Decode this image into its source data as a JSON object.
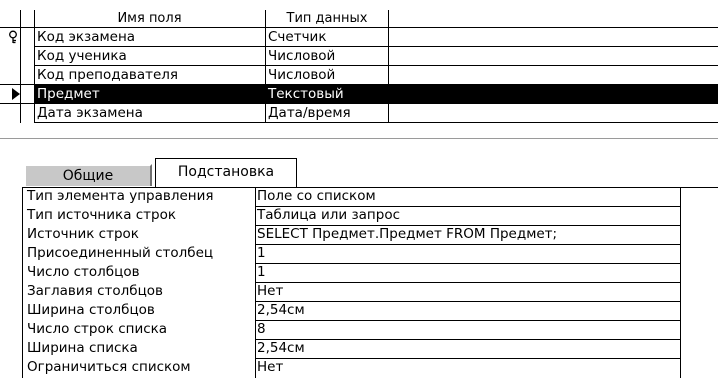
{
  "field_grid": {
    "columns": {
      "name": "Имя поля",
      "type": "Тип данных"
    },
    "rows": [
      {
        "name": "Код экзамена",
        "type": "Счетчик",
        "indicator": "key-icon"
      },
      {
        "name": "Код ученика",
        "type": "Числовой",
        "indicator": ""
      },
      {
        "name": "Код преподавателя",
        "type": "Числовой",
        "indicator": ""
      },
      {
        "name": "Предмет",
        "type": "Текстовый",
        "indicator": "current-row-arrow-icon",
        "selected": true
      },
      {
        "name": "Дата экзамена",
        "type": "Дата/время",
        "indicator": ""
      }
    ]
  },
  "tabs": {
    "general": "Общие",
    "lookup": "Подстановка",
    "active": "lookup"
  },
  "properties": [
    {
      "label": "Тип элемента управления",
      "value": "Поле со списком"
    },
    {
      "label": "Тип источника строк",
      "value": "Таблица или запрос"
    },
    {
      "label": "Источник строк",
      "value": "SELECT Предмет.Предмет FROM Предмет;"
    },
    {
      "label": "Присоединенный столбец",
      "value": "1"
    },
    {
      "label": "Число столбцов",
      "value": "1"
    },
    {
      "label": "Заглавия столбцов",
      "value": "Нет"
    },
    {
      "label": "Ширина столбцов",
      "value": "2,54см"
    },
    {
      "label": "Число строк списка",
      "value": "8"
    },
    {
      "label": "Ширина списка",
      "value": "2,54см"
    },
    {
      "label": "Ограничиться списком",
      "value": "Нет"
    }
  ],
  "colors": {
    "selected_row_bg": "#000000",
    "selected_row_text": "#ffffff",
    "inactive_tab_bg": "#c8c8c8"
  }
}
